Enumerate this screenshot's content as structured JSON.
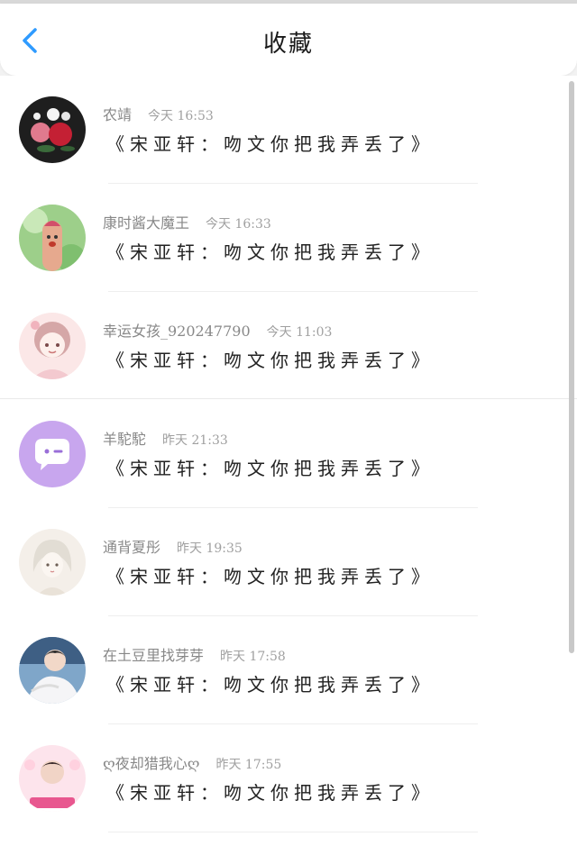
{
  "header": {
    "title": "收藏",
    "back_icon": "chevron-left-icon",
    "back_color": "#2f9bff"
  },
  "items": [
    {
      "name": "农靖",
      "time": "今天 16:53",
      "message": "《宋亚轩：吻文你把我弄丢了》",
      "avatar": "roses-avatar"
    },
    {
      "name": "康时酱大魔王",
      "time": "今天 16:33",
      "message": "《宋亚轩：吻文你把我弄丢了》",
      "avatar": "finger-face-avatar"
    },
    {
      "name": "幸运女孩_920247790",
      "time": "今天 11:03",
      "message": "《宋亚轩：吻文你把我弄丢了》",
      "avatar": "anime-girl-avatar"
    },
    {
      "name": "羊駝駝",
      "time": "昨天 21:33",
      "message": "《宋亚轩：吻文你把我弄丢了》",
      "avatar": "purple-chat-avatar"
    },
    {
      "name": "通背夏彤",
      "time": "昨天 19:35",
      "message": "《宋亚轩：吻文你把我弄丢了》",
      "avatar": "sketch-girl-avatar"
    },
    {
      "name": "在土豆里找芽芽",
      "time": "昨天 17:58",
      "message": "《宋亚轩：吻文你把我弄丢了》",
      "avatar": "boy-white-avatar"
    },
    {
      "name": "ღ夜却猎我心ღ",
      "time": "昨天 17:55",
      "message": "《宋亚轩：吻文你把我弄丢了》",
      "avatar": "pink-idol-avatar"
    }
  ]
}
